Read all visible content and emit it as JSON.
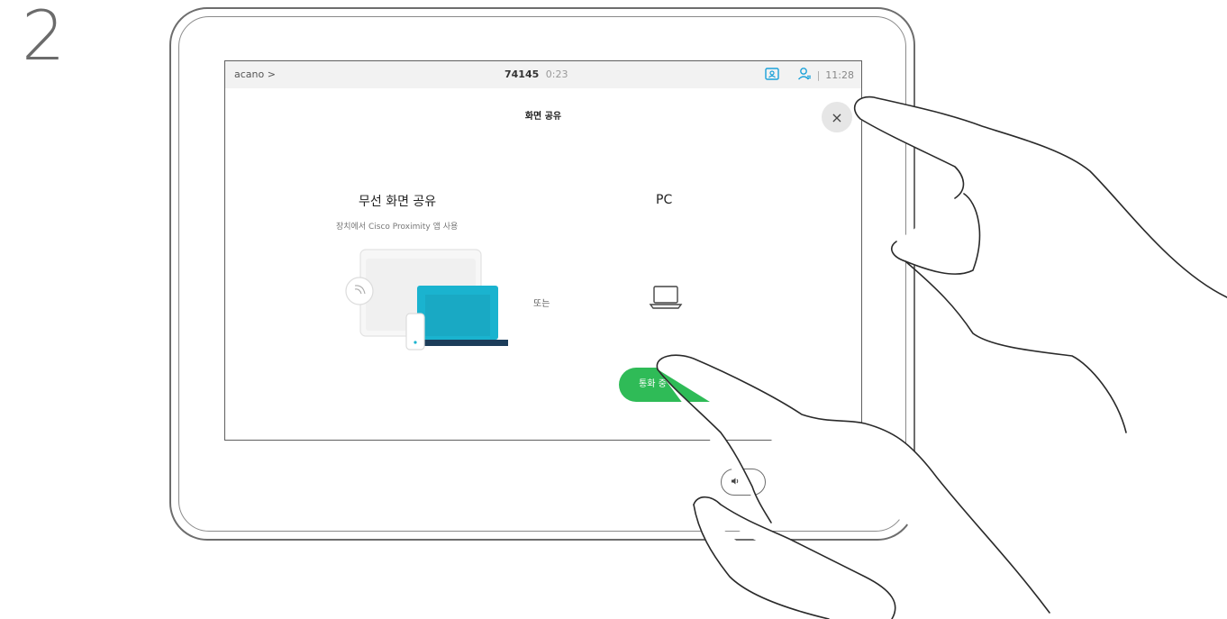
{
  "step": {
    "number": "2"
  },
  "status_bar": {
    "call_name": "acano >",
    "call_number": "74145",
    "call_duration": "0:23",
    "clock": "11:28",
    "separator": "|"
  },
  "panel": {
    "title": "화면 공유",
    "close_label": "×"
  },
  "wireless_option": {
    "title": "무선 화면 공유",
    "subtitle": "장치에서 Cisco Proximity 앱 사용"
  },
  "or_label": "또는",
  "pc_option": {
    "title": "PC"
  },
  "call_share_button": {
    "label": "통화 중"
  },
  "colors": {
    "accent_green": "#2fbb57",
    "laptop_teal": "#1ab3cf",
    "laptop_base": "#1c3d5a",
    "status_icon_blue": "#1aa1d9"
  },
  "icons": {
    "share_icon": "screen-share-icon",
    "people_icon": "participants-icon",
    "pc_icon": "laptop-outline-icon",
    "volume_icon": "speaker-icon",
    "wireless_icon": "wireless-signal-icon"
  }
}
